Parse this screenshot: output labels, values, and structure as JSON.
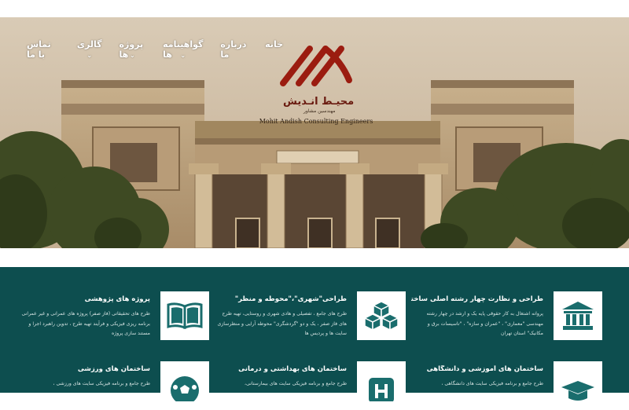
{
  "nav": {
    "items": [
      {
        "label": "خانه",
        "has_dropdown": false
      },
      {
        "label": "درباره ما",
        "has_dropdown": false
      },
      {
        "label": "گواهینامه ها",
        "has_dropdown": true
      },
      {
        "label": "پروژه ها",
        "has_dropdown": true
      },
      {
        "label": "گالری",
        "has_dropdown": true
      },
      {
        "label": "تماس با ما",
        "has_dropdown": false
      }
    ]
  },
  "logo": {
    "persian_name": "محیـط انـدیش",
    "persian_subtitle": "مهندسین مشاور",
    "english_name": "Mohit Andish Consulting Engineers",
    "brand_color": "#9b1c10"
  },
  "colors": {
    "services_bg": "#0d4e4f",
    "icon_color": "#1a6d6d"
  },
  "services": [
    {
      "icon": "bank-building-icon",
      "title": "طراحی و نظارت چهار رشته اصلی ساختمان",
      "desc": "پروانه اشتغال به کار حقوقی پایه یک و ارشد در چهار رشته مهندسی \"معماری\" ، \"عمران و سازه\" ، \"تاسیسات برق و مکانیک\" استان تهران"
    },
    {
      "icon": "cubes-icon",
      "title": "طراحی\"شهری\"،\"محوطه و منظر\"",
      "desc": "طرح های جامع ، تفصیلی و هادی شهری و روستایی، تهیه طرح های فاز صفر ، یک و دو \"گردشگری\" محوطه آرایی و منظرسازی سایت ها و پردیس ها"
    },
    {
      "icon": "open-book-icon",
      "title": "پروژه های پژوهشی",
      "desc": "طرح های تحقیقاتی (فاز صفر) پروژه های عمرانی و غیر عمرانی برنامه ریزی فیزیکی و فرآیند تهیه طرح ، تدوین راهبرد اجرا و مستند سازی پروژه"
    },
    {
      "icon": "graduation-cap-icon",
      "title": "ساختمان های آموزشی و دانشگاهی",
      "desc": "طرح جامع و برنامه فیزیکی سایت های دانشگاهی ،"
    },
    {
      "icon": "hospital-icon",
      "title": "ساختمان های بهداشتی و درمانی",
      "desc": "طرح جامع و برنامه فیزیکی سایت های بیمارستانی،"
    },
    {
      "icon": "soccer-ball-icon",
      "title": "ساختمان های ورزشی",
      "desc": "طرح جامع و برنامه فیزیکی سایت های ورزشی ،"
    }
  ]
}
